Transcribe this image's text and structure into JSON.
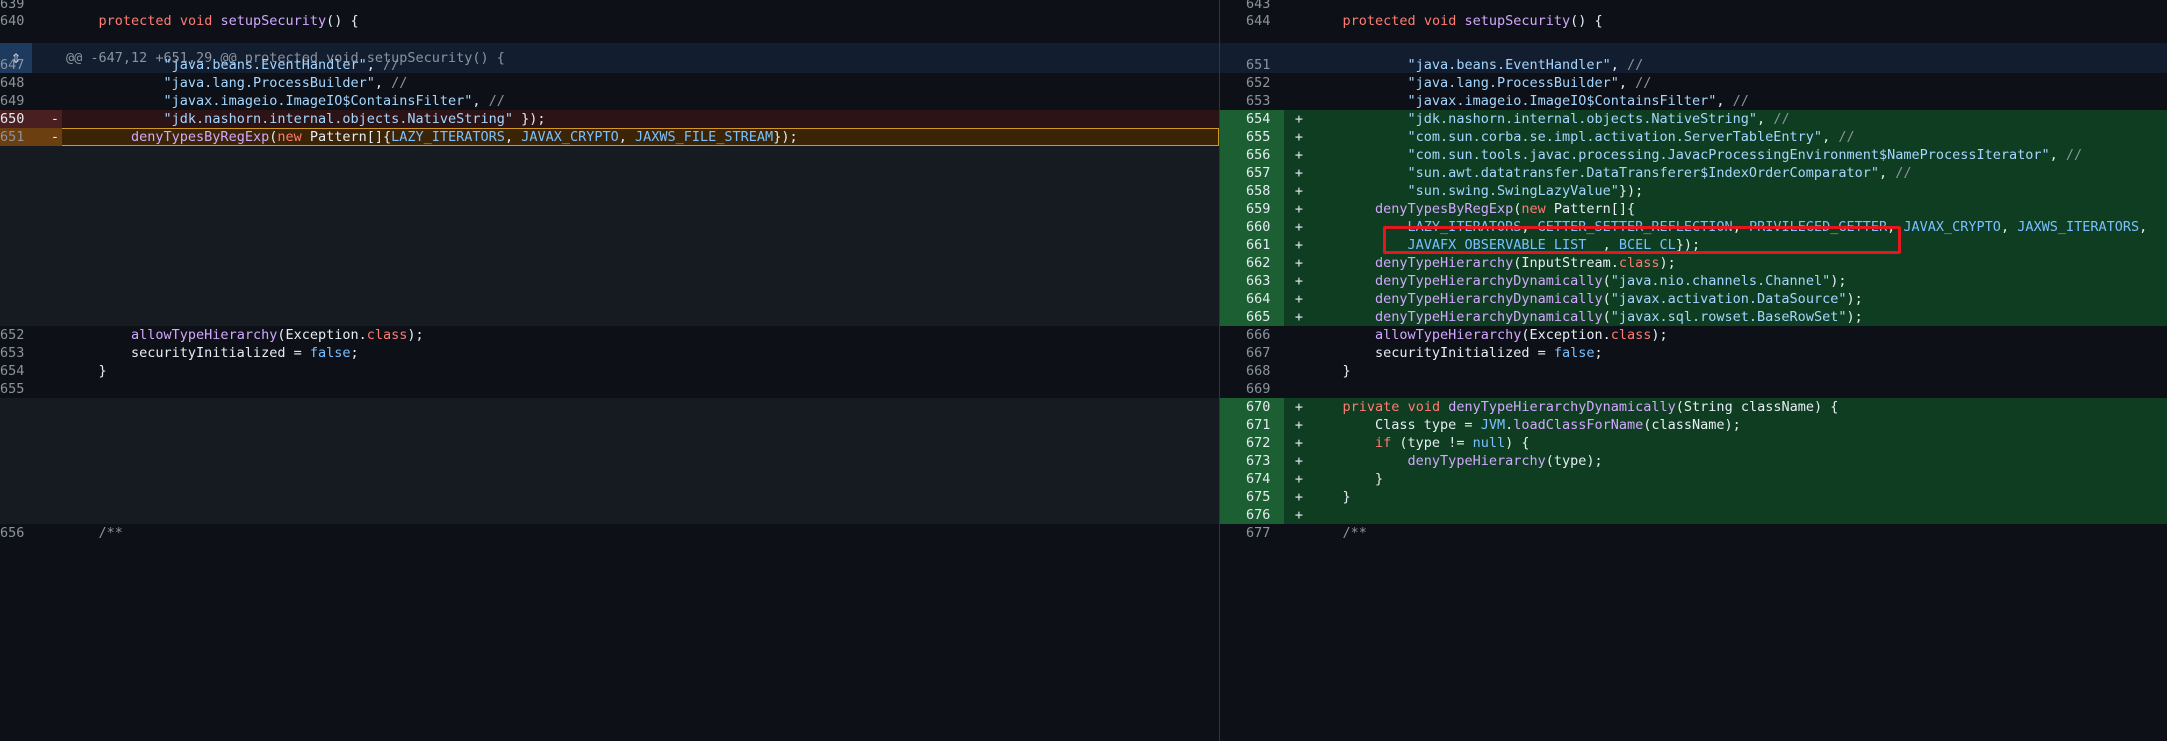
{
  "hunk_header": "@@ -647,12 +651,29 @@ protected void setupSecurity() {",
  "rows": [
    {
      "type": "context",
      "left": {
        "ln": "639",
        "code": ""
      },
      "right": {
        "ln": "643",
        "code": ""
      }
    },
    {
      "type": "context",
      "left": {
        "ln": "640",
        "code": "    protected void setupSecurity() {"
      },
      "right": {
        "ln": "644",
        "code": "    protected void setupSecurity() {"
      }
    },
    {
      "type": "context",
      "left": {
        "ln": "647",
        "code": "            \"java.beans.EventHandler\", //"
      },
      "right": {
        "ln": "651",
        "code": "            \"java.beans.EventHandler\", //"
      }
    },
    {
      "type": "context",
      "left": {
        "ln": "648",
        "code": "            \"java.lang.ProcessBuilder\", //"
      },
      "right": {
        "ln": "652",
        "code": "            \"java.lang.ProcessBuilder\", //"
      }
    },
    {
      "type": "context",
      "left": {
        "ln": "649",
        "code": "            \"javax.imageio.ImageIO$ContainsFilter\", //"
      },
      "right": {
        "ln": "653",
        "code": "            \"javax.imageio.ImageIO$ContainsFilter\", //"
      }
    },
    {
      "type": "change",
      "left": {
        "ln": "650",
        "mark": "-",
        "code": "            \"jdk.nashorn.internal.objects.NativeString\" });"
      },
      "right": {
        "ln": "654",
        "mark": "+",
        "code": "            \"jdk.nashorn.internal.objects.NativeString\", //"
      }
    },
    {
      "type": "change",
      "highlight": true,
      "left": {
        "ln": "651",
        "mark": "-",
        "code": "        denyTypesByRegExp(new Pattern[]{LAZY_ITERATORS, JAVAX_CRYPTO, JAXWS_FILE_STREAM});"
      },
      "right": {
        "ln": "655",
        "mark": "+",
        "code": "            \"com.sun.corba.se.impl.activation.ServerTableEntry\", //"
      }
    },
    {
      "type": "add",
      "right": {
        "ln": "656",
        "mark": "+",
        "code": "            \"com.sun.tools.javac.processing.JavacProcessingEnvironment$NameProcessIterator\", //"
      }
    },
    {
      "type": "add",
      "right": {
        "ln": "657",
        "mark": "+",
        "code": "            \"sun.awt.datatransfer.DataTransferer$IndexOrderComparator\", //"
      }
    },
    {
      "type": "add",
      "right": {
        "ln": "658",
        "mark": "+",
        "code": "            \"sun.swing.SwingLazyValue\"});"
      }
    },
    {
      "type": "add",
      "right": {
        "ln": "659",
        "mark": "+",
        "code": "        denyTypesByRegExp(new Pattern[]{"
      }
    },
    {
      "type": "add",
      "right": {
        "ln": "660",
        "mark": "+",
        "code": "            LAZY_ITERATORS, GETTER_SETTER_REFLECTION, PRIVILEGED_GETTER, JAVAX_CRYPTO, JAXWS_ITERATORS,"
      }
    },
    {
      "type": "add",
      "right": {
        "ln": "661",
        "mark": "+",
        "code": "            JAVAFX_OBSERVABLE_LIST__, BCEL_CL});"
      }
    },
    {
      "type": "add",
      "right": {
        "ln": "662",
        "mark": "+",
        "code": "        denyTypeHierarchy(InputStream.class);"
      }
    },
    {
      "type": "add",
      "right": {
        "ln": "663",
        "mark": "+",
        "code": "        denyTypeHierarchyDynamically(\"java.nio.channels.Channel\");"
      }
    },
    {
      "type": "add",
      "right": {
        "ln": "664",
        "mark": "+",
        "code": "        denyTypeHierarchyDynamically(\"javax.activation.DataSource\");"
      }
    },
    {
      "type": "add",
      "right": {
        "ln": "665",
        "mark": "+",
        "code": "        denyTypeHierarchyDynamically(\"javax.sql.rowset.BaseRowSet\");"
      }
    },
    {
      "type": "context",
      "left": {
        "ln": "652",
        "code": "        allowTypeHierarchy(Exception.class);"
      },
      "right": {
        "ln": "666",
        "code": "        allowTypeHierarchy(Exception.class);"
      }
    },
    {
      "type": "context",
      "left": {
        "ln": "653",
        "code": "        securityInitialized = false;"
      },
      "right": {
        "ln": "667",
        "code": "        securityInitialized = false;"
      }
    },
    {
      "type": "context",
      "left": {
        "ln": "654",
        "code": "    }"
      },
      "right": {
        "ln": "668",
        "code": "    }"
      }
    },
    {
      "type": "context",
      "left": {
        "ln": "655",
        "code": ""
      },
      "right": {
        "ln": "669",
        "code": ""
      }
    },
    {
      "type": "add",
      "right": {
        "ln": "670",
        "mark": "+",
        "code": "    private void denyTypeHierarchyDynamically(String className) {"
      }
    },
    {
      "type": "add",
      "right": {
        "ln": "671",
        "mark": "+",
        "code": "        Class type = JVM.loadClassForName(className);"
      }
    },
    {
      "type": "add",
      "right": {
        "ln": "672",
        "mark": "+",
        "code": "        if (type != null) {"
      }
    },
    {
      "type": "add",
      "right": {
        "ln": "673",
        "mark": "+",
        "code": "            denyTypeHierarchy(type);"
      }
    },
    {
      "type": "add",
      "right": {
        "ln": "674",
        "mark": "+",
        "code": "        }"
      }
    },
    {
      "type": "add",
      "right": {
        "ln": "675",
        "mark": "+",
        "code": "    }"
      }
    },
    {
      "type": "add",
      "right": {
        "ln": "676",
        "mark": "+",
        "code": ""
      }
    },
    {
      "type": "context",
      "left": {
        "ln": "656",
        "code": "    /**"
      },
      "right": {
        "ln": "677",
        "code": "    /**"
      }
    }
  ],
  "colors": {
    "background": "#0d1117",
    "deletion": "#2c1416",
    "addition": "#0f3d21",
    "highlight_border": "#d29922",
    "annotation_box": "#e5161d"
  },
  "icons": {
    "expand": "unfold-icon"
  }
}
